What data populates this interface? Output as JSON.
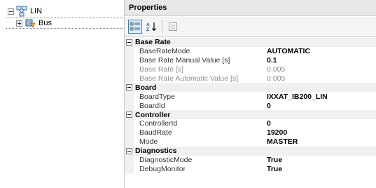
{
  "tree": {
    "root_label": "LIN",
    "child_label": "Bus"
  },
  "properties": {
    "header": "Properties",
    "toolbar": {
      "categorized_icon": "categorized-icon",
      "alphabetical_icon": "alphabetical-icon",
      "property_pages_icon": "property-pages-icon"
    },
    "categories": [
      {
        "name": "Base Rate",
        "rows": [
          {
            "name": "BaseRateMode",
            "value": "AUTOMATIC",
            "disabled": false
          },
          {
            "name": "Base Rate Manual Value [s]",
            "value": "0.1",
            "disabled": false
          },
          {
            "name": "Base Rate [s]",
            "value": "0.005",
            "disabled": true
          },
          {
            "name": "Base Rate Automatic Value [s]",
            "value": "0.005",
            "disabled": true
          }
        ]
      },
      {
        "name": "Board",
        "rows": [
          {
            "name": "BoardType",
            "value": "IXXAT_IB200_LIN",
            "disabled": false
          },
          {
            "name": "BoardId",
            "value": "0",
            "disabled": false
          }
        ]
      },
      {
        "name": "Controller",
        "rows": [
          {
            "name": "ControllerId",
            "value": "0",
            "disabled": false
          },
          {
            "name": "BaudRate",
            "value": "19200",
            "disabled": false
          },
          {
            "name": "Mode",
            "value": "MASTER",
            "disabled": false
          }
        ]
      },
      {
        "name": "Diagnostics",
        "rows": [
          {
            "name": "DiagnosticMode",
            "value": "True",
            "disabled": false
          },
          {
            "name": "DebugMonitor",
            "value": "True",
            "disabled": false
          }
        ]
      }
    ]
  },
  "colors": {
    "header_bg": "#e7e7e7",
    "category_bg": "#f0f0f0",
    "disabled_text": "#8e8e8e",
    "selected_tool_border": "#3c7fb1"
  }
}
